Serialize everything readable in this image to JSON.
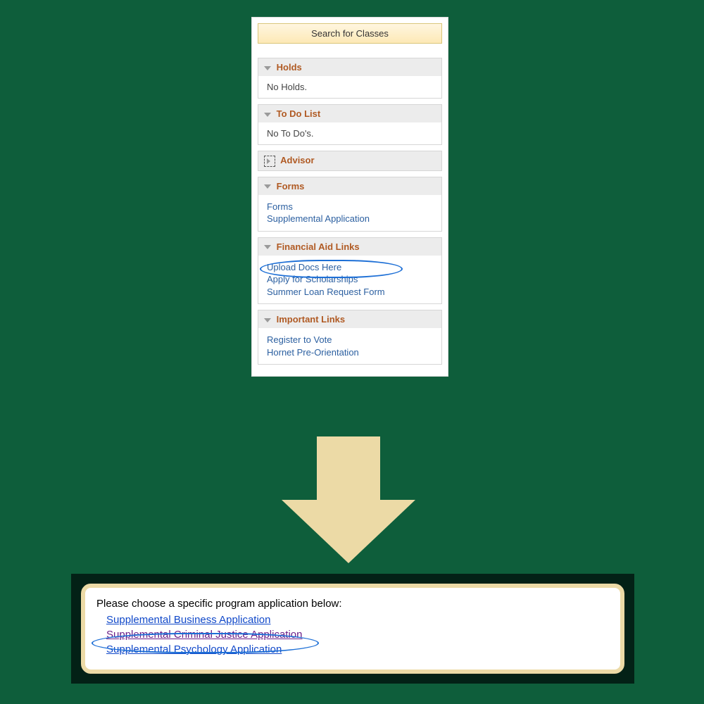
{
  "portal": {
    "search_button": "Search for Classes",
    "holds": {
      "title": "Holds",
      "body": "No Holds."
    },
    "todo": {
      "title": "To Do List",
      "body": "No To Do's."
    },
    "advisor": {
      "title": "Advisor"
    },
    "forms": {
      "title": "Forms",
      "links": {
        "forms": "Forms",
        "supplemental": "Supplemental Application"
      }
    },
    "finaid": {
      "title": "Financial Aid Links",
      "links": {
        "upload": "Upload Docs Here",
        "scholarships": "Apply for Scholarships",
        "summer": "Summer Loan Request Form"
      }
    },
    "important": {
      "title": "Important Links",
      "links": {
        "vote": "Register to Vote",
        "orientation": "Hornet Pre-Orientation"
      }
    }
  },
  "choice": {
    "prompt": "Please choose a specific program application below:",
    "business": "Supplemental Business Application",
    "cj": "Supplemental Criminal Justice Application",
    "psych": "Supplemental Psychology Application"
  }
}
